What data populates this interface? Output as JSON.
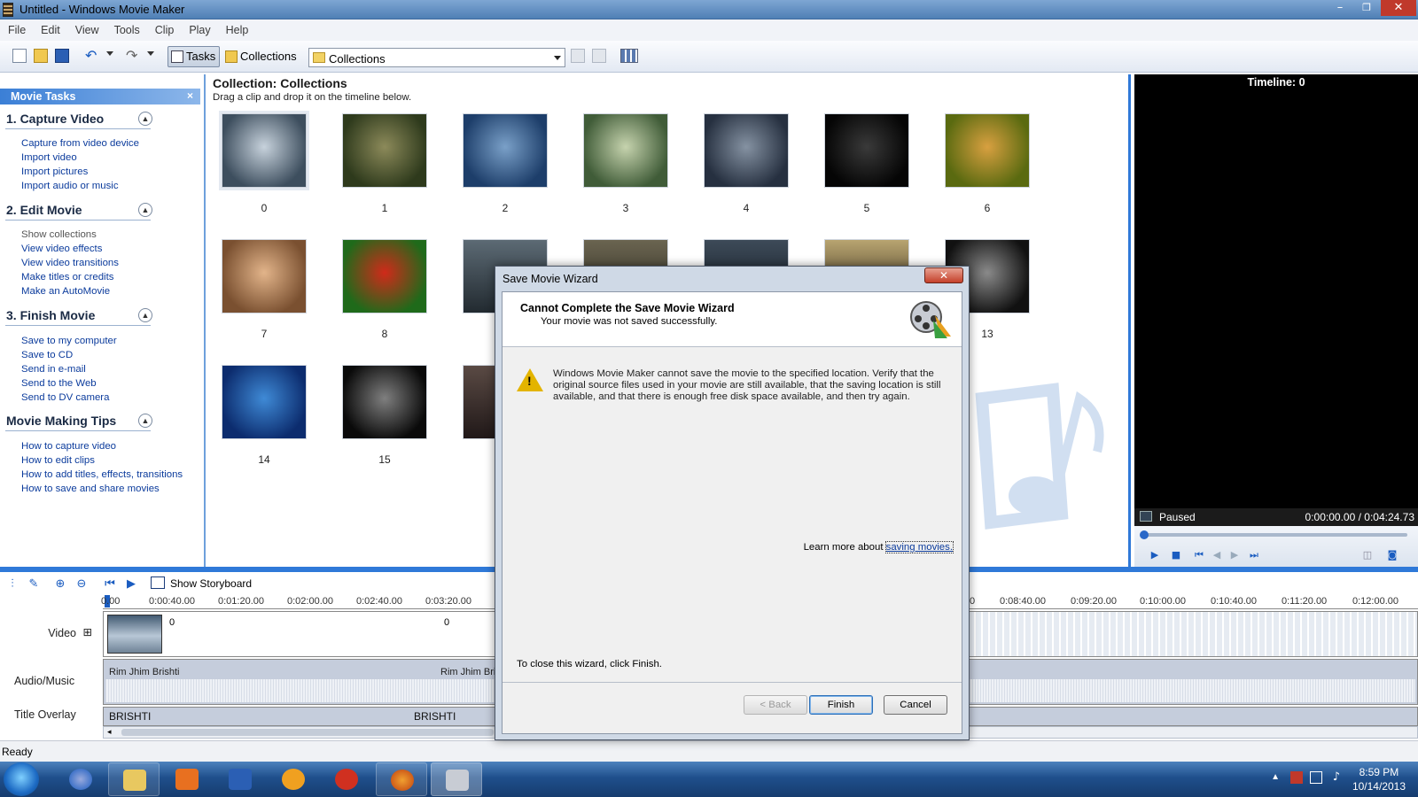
{
  "window": {
    "title": "Untitled - Windows Movie Maker",
    "minimize": "–",
    "restore": "❐",
    "close": "✕"
  },
  "menu": [
    "File",
    "Edit",
    "View",
    "Tools",
    "Clip",
    "Play",
    "Help"
  ],
  "toolbar": {
    "tasks_label": "Tasks",
    "collections_label": "Collections",
    "combo_value": "Collections"
  },
  "task_pane": {
    "title": "Movie Tasks",
    "close": "×",
    "sections": [
      {
        "title": "1. Capture Video",
        "links": [
          "Capture from video device",
          "Import video",
          "Import pictures",
          "Import audio or music"
        ]
      },
      {
        "title": "2. Edit Movie",
        "links": [
          "Show collections",
          "View video effects",
          "View video transitions",
          "Make titles or credits",
          "Make an AutoMovie"
        ]
      },
      {
        "title": "3. Finish Movie",
        "links": [
          "Save to my computer",
          "Save to CD",
          "Send in e-mail",
          "Send to the Web",
          "Send to DV camera"
        ]
      },
      {
        "title": "Movie Making Tips",
        "links": [
          "How to capture video",
          "How to edit clips",
          "How to add titles, effects, transitions",
          "How to save and share movies"
        ]
      }
    ]
  },
  "collection": {
    "title": "Collection: Collections",
    "subtitle": "Drag a clip and drop it on the timeline below.",
    "clips": [
      {
        "label": "0",
        "colors": [
          "#3d4e5e",
          "#c7d2dc"
        ]
      },
      {
        "label": "1",
        "colors": [
          "#2e3a1c",
          "#8c8a5a"
        ]
      },
      {
        "label": "2",
        "colors": [
          "#1d3e6a",
          "#7aa0c8"
        ]
      },
      {
        "label": "3",
        "colors": [
          "#405c38",
          "#c6d3ae"
        ]
      },
      {
        "label": "4",
        "colors": [
          "#263040",
          "#8592a2"
        ]
      },
      {
        "label": "5",
        "colors": [
          "#050505",
          "#3a3a3a"
        ]
      },
      {
        "label": "6",
        "colors": [
          "#5a6a10",
          "#d8a040"
        ]
      },
      {
        "label": "7",
        "colors": [
          "#7a5030",
          "#e2b48a"
        ]
      },
      {
        "label": "8",
        "colors": [
          "#1f6a1a",
          "#d02a1a"
        ]
      },
      {
        "label": "13",
        "colors": [
          "#111111",
          "#8a8a8a"
        ]
      },
      {
        "label": "14",
        "colors": [
          "#0c2c6e",
          "#3f8ad6"
        ]
      },
      {
        "label": "15",
        "colors": [
          "#0a0a0a",
          "#7f7f7f"
        ]
      }
    ],
    "hidden_thumbs": [
      {
        "colors": [
          "#222a30",
          "#5c6a74"
        ]
      },
      {
        "colors": [
          "#2c2a20",
          "#6a6450"
        ]
      },
      {
        "colors": [
          "#101820",
          "#3d4a58"
        ]
      },
      {
        "colors": [
          "#2a2214",
          "#b8a470"
        ]
      },
      {
        "colors": [
          "#201818",
          "#5a4a44"
        ]
      }
    ]
  },
  "preview": {
    "timeline_label": "Timeline: 0",
    "status": "Paused",
    "time": "0:00:00.00 / 0:04:24.73"
  },
  "timeline": {
    "show_storyboard": "Show Storyboard",
    "ruler_left": [
      "0.00",
      "0:00:40.00",
      "0:01:20.00",
      "0:02:00.00",
      "0:02:40.00",
      "0:03:20.00"
    ],
    "ruler_right": [
      "0",
      "0:08:40.00",
      "0:09:20.00",
      "0:10:00.00",
      "0:10:40.00",
      "0:11:20.00",
      "0:12:00.00"
    ],
    "tracks": {
      "video": "Video",
      "audio": "Audio/Music",
      "title": "Title Overlay"
    },
    "video_expand": "⊞",
    "video_clip_labels": [
      "0",
      "0"
    ],
    "audio_clip_labels": [
      "Rim Jhim Brishti",
      "Rim Jhim Bris"
    ],
    "title_clip_labels": [
      "BRISHTI",
      "BRISHTI"
    ]
  },
  "status": "Ready",
  "clock": {
    "time": "8:59 PM",
    "date": "10/14/2013"
  },
  "dialog": {
    "title": "Save Movie Wizard",
    "close": "✕",
    "heading": "Cannot Complete the Save Movie Wizard",
    "subheading": "Your movie was not saved successfully.",
    "message": "Windows Movie Maker cannot save the movie to the specified location. Verify that the original source files used in your movie are still available, that the saving location is still available, and that there is enough free disk space available, and then try again.",
    "learn_more_prefix": "Learn more about ",
    "learn_more_link": "saving movies.",
    "close_info": "To close this wizard, click Finish.",
    "back_button": "< Back",
    "finish_button": "Finish",
    "cancel_button": "Cancel"
  }
}
